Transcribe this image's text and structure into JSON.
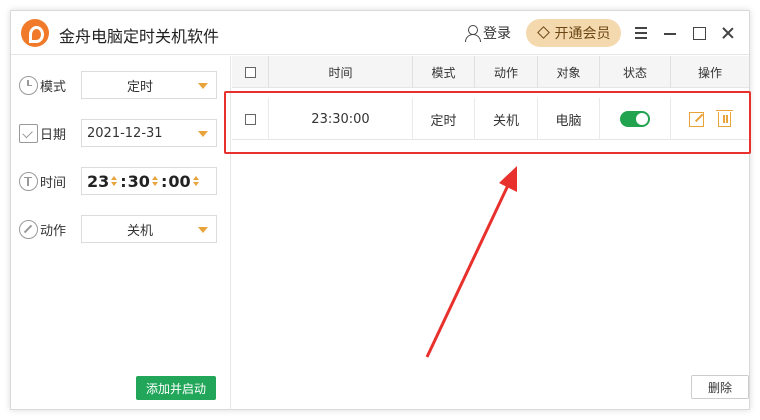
{
  "app": {
    "title": "金舟电脑定时关机软件",
    "login_label": "登录",
    "vip_label": "开通会员"
  },
  "form": {
    "mode_label": "模式",
    "mode_value": "定时",
    "date_label": "日期",
    "date_value": "2021-12-31",
    "time_label": "时间",
    "hour": "23",
    "minute": "30",
    "second": "00",
    "action_label": "动作",
    "action_value": "关机",
    "add_button": "添加并启动"
  },
  "table": {
    "headers": [
      "时间",
      "模式",
      "动作",
      "对象",
      "状态",
      "操作"
    ],
    "rows": [
      {
        "time": "23:30:00",
        "mode": "定时",
        "action": "关机",
        "target": "电脑",
        "enabled": true
      }
    ],
    "delete_button": "删除"
  },
  "colors": {
    "accent": "#e8a33b",
    "green": "#21a65a",
    "highlight": "#e8302c",
    "vip_bg": "#f5d9ae"
  }
}
